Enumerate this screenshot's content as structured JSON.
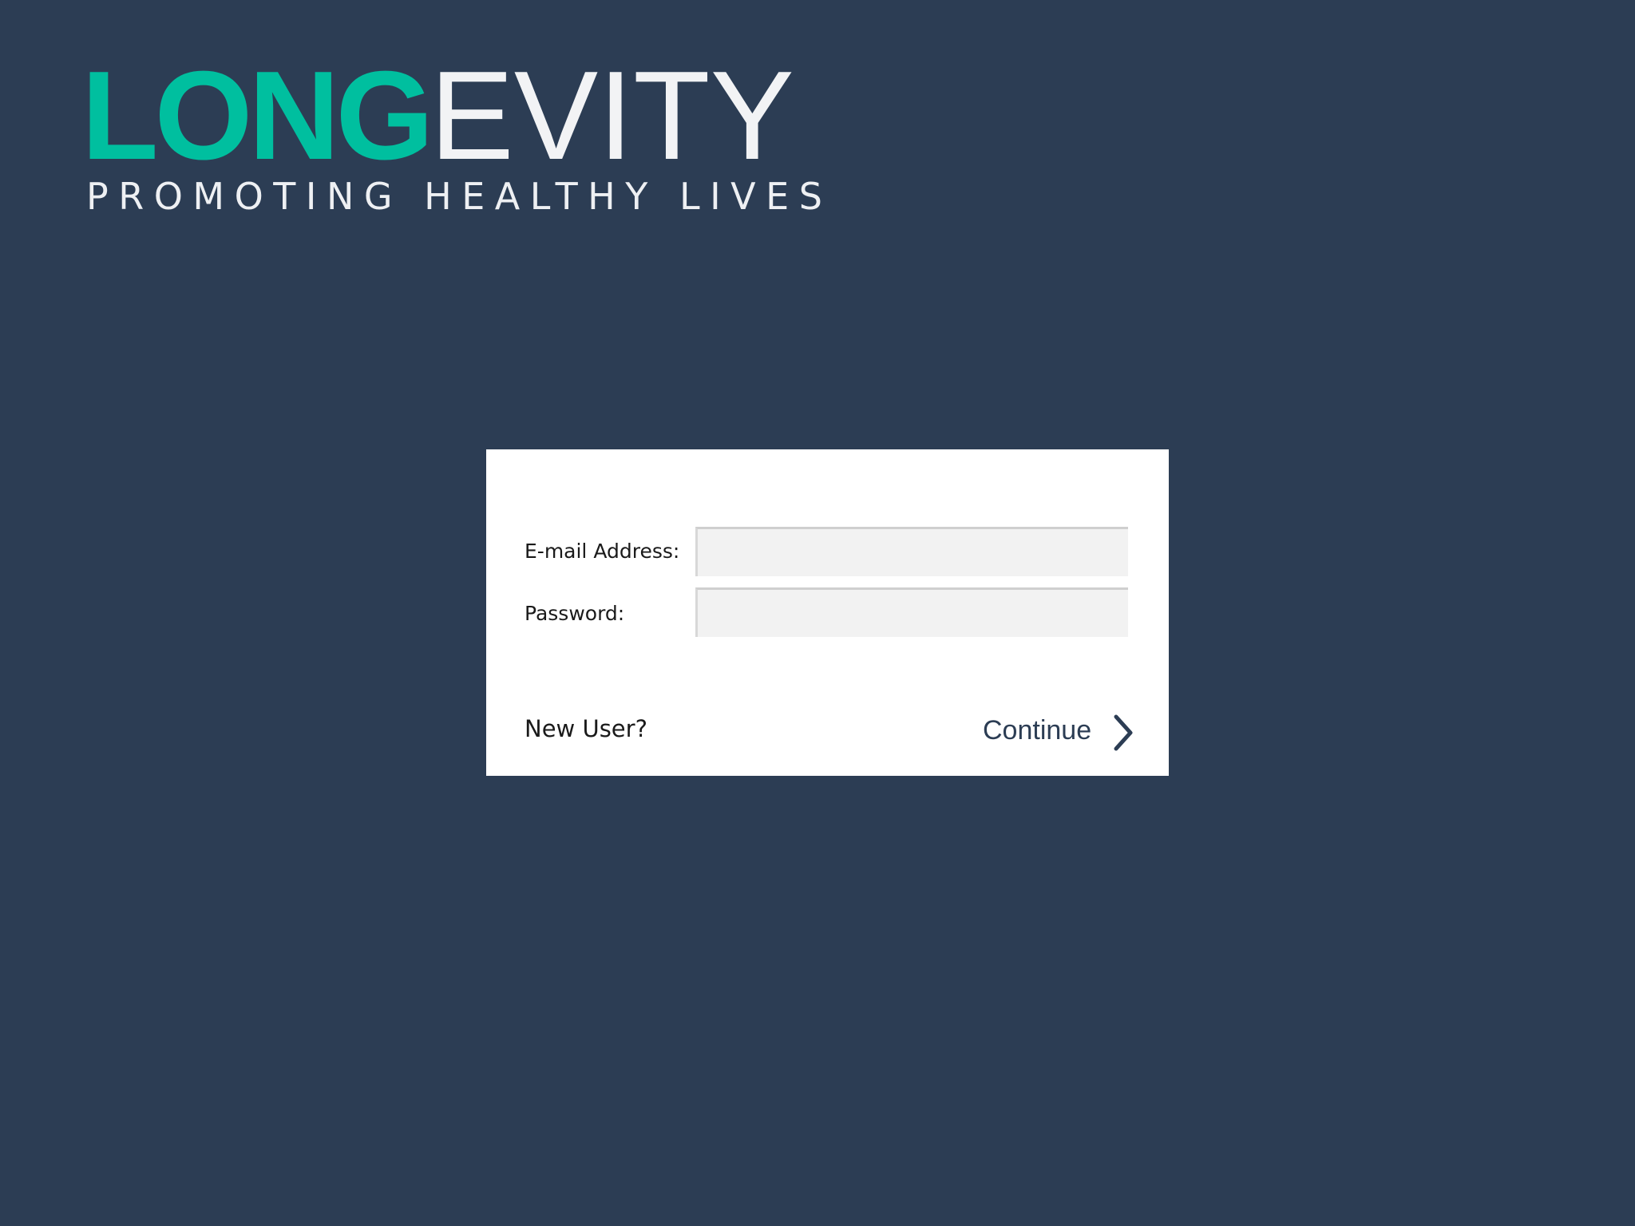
{
  "colors": {
    "background": "#2c3d54",
    "brand_accent": "#00bf9f",
    "logo_light": "#f2f3f5",
    "tagline": "#eef0f3",
    "card_background": "#ffffff",
    "continue_text": "#2c3d54"
  },
  "brand": {
    "logo_part_accent": "LONG",
    "logo_part_light": "EVITY",
    "tagline": "PROMOTING HEALTHY LIVES"
  },
  "login": {
    "email_label": "E-mail Address:",
    "email_value": "",
    "password_label": "Password:",
    "password_value": "",
    "new_user_label": "New User?",
    "continue_label": "Continue",
    "continue_icon": "chevron-right-icon"
  }
}
